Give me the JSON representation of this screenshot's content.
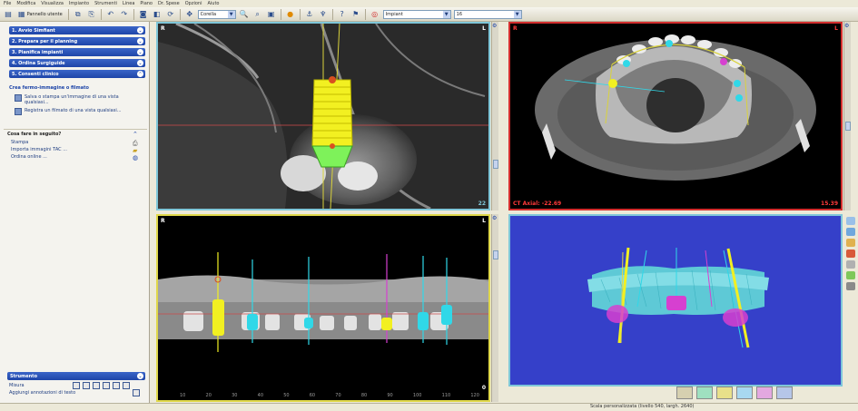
{
  "menubar": [
    "File",
    "Modifica",
    "Visualizza",
    "Impianto",
    "Strumenti",
    "Linea",
    "Piano",
    "Dr. Spese",
    "Opzioni",
    "Aiuto"
  ],
  "toolbar": {
    "panel_button": "Pannello utente",
    "select_view": "Corella",
    "select_layer": "Impiant",
    "select_number": "16"
  },
  "sidebar": {
    "steps": [
      {
        "label": "1. Avvio Simfiant"
      },
      {
        "label": "2. Prepara per il planning"
      },
      {
        "label": "3. Pianifica impianti"
      },
      {
        "label": "4. Ordina Surgiguide"
      },
      {
        "label": "5. Consenti clinico"
      }
    ],
    "info_box": {
      "title": "Crea fermo-immagine o filmato",
      "items": [
        "Salva o stampa un'immagine di una vista qualsiasi...",
        "Registra un filmato di una vista qualsiasi..."
      ]
    },
    "next_box": {
      "title": "Cosa fare in seguito?",
      "items": [
        "Stampa",
        "Importa immagini TAC ...",
        "Ordina online ..."
      ]
    },
    "tools": {
      "header": "Strumento",
      "items": [
        "Misura",
        "Aggiungi annotazioni di testo"
      ]
    }
  },
  "views": {
    "top_left": {
      "corner_tl": "R",
      "corner_tr": "L",
      "corner_br": "22"
    },
    "top_right": {
      "corner_tl": "R",
      "corner_tr": "L",
      "footer_left": "CT Axial: -22.69",
      "footer_right": "15.39"
    },
    "bottom_left": {
      "corner_tl": "R",
      "corner_tr": "L",
      "corner_br": "0",
      "scale_ticks": [
        "10",
        "20",
        "30",
        "40",
        "50",
        "60",
        "70",
        "80",
        "90",
        "100",
        "110",
        "120"
      ]
    }
  },
  "status": {
    "text": "Scala personalizzata (livello 540, largh. 2640)"
  },
  "colors": {
    "implant_yellow": "#f2f021",
    "implant_cyan": "#30d8e8",
    "implant_magenta": "#d640d0",
    "panel_cyan_border": "#7fc7d9",
    "panel_red_border": "#d32e2e",
    "bg_3d": "#3540c9",
    "wizard_blue": "#1e45a8"
  },
  "icons": [
    "undo-icon",
    "redo-icon",
    "zoom-icon",
    "search-icon",
    "print-icon",
    "info-icon",
    "help-icon"
  ]
}
